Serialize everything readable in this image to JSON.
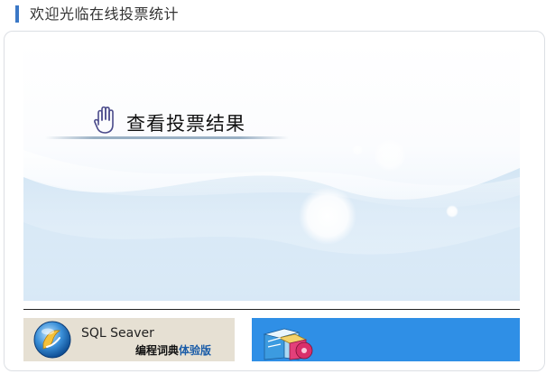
{
  "header": {
    "title": "欢迎光临在线投票统计"
  },
  "hero": {
    "title": "查看投票结果",
    "icon": "hand-icon"
  },
  "banners": {
    "sql": {
      "name": "SQL Seaver",
      "subtitle": "编程词典",
      "edition": "体验版",
      "icon": "sql-seaver-logo-icon"
    },
    "blue": {
      "icon": "software-box-icon"
    }
  },
  "colors": {
    "header_bar": "#3b78c6",
    "blue_banner": "#2f8fe6",
    "sql_banner": "#e6e0d3"
  }
}
